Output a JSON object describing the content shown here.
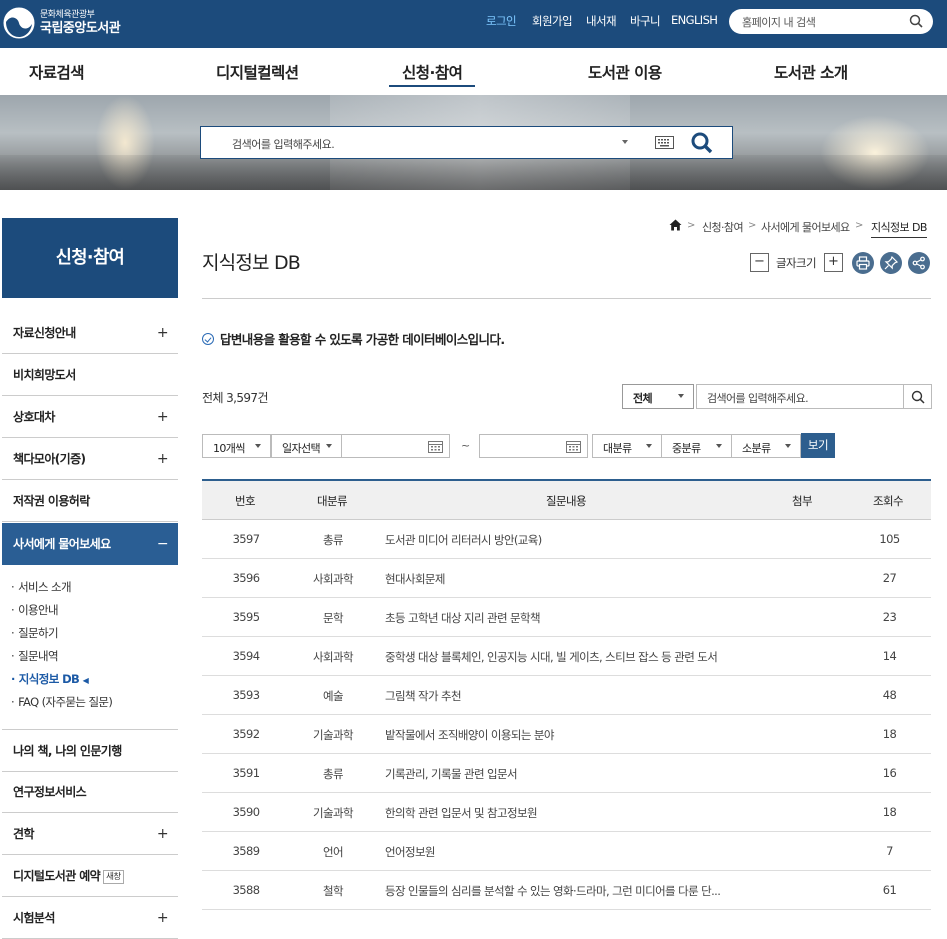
{
  "header": {
    "org_sub": "문화체육관광부",
    "org_main": "국립중앙도서관",
    "util_links": [
      "로그인",
      "회원가입",
      "내서재",
      "바구니",
      "ENGLISH"
    ],
    "site_search_placeholder": "홈페이지 내 검색"
  },
  "gnb": [
    "자료검색",
    "디지털컬렉션",
    "신청·참여",
    "도서관 이용",
    "도서관 소개"
  ],
  "main_search": {
    "placeholder": "검색어를 입력해주세요."
  },
  "sidebar": {
    "title": "신청·참여",
    "items": [
      {
        "label": "자료신청안내",
        "toggle": "+"
      },
      {
        "label": "비치희망도서",
        "toggle": ""
      },
      {
        "label": "상호대차",
        "toggle": "+"
      },
      {
        "label": "책다모아(기증)",
        "toggle": "+"
      },
      {
        "label": "저작권 이용허락",
        "toggle": ""
      },
      {
        "label": "사서에게 물어보세요",
        "toggle": "−"
      }
    ],
    "sub_items": [
      {
        "label": "서비스 소개"
      },
      {
        "label": "이용안내"
      },
      {
        "label": "질문하기"
      },
      {
        "label": "질문내역"
      },
      {
        "label": "지식정보 DB",
        "marker": "◀"
      },
      {
        "label": "FAQ (자주묻는 질문)"
      }
    ],
    "items_after": [
      {
        "label": "나의 책, 나의 인문기행",
        "toggle": ""
      },
      {
        "label": "연구정보서비스",
        "toggle": ""
      },
      {
        "label": "견학",
        "toggle": "+"
      },
      {
        "label": "디지털도서관 예약",
        "toggle": "",
        "badge": "새창"
      },
      {
        "label": "시험분석",
        "toggle": "+"
      }
    ]
  },
  "breadcrumb": [
    "신청·참여",
    "사서에게 물어보세요",
    "지식정보 DB"
  ],
  "page": {
    "title": "지식정보 DB",
    "font_size_label": "글자크기",
    "font_minus": "−",
    "font_plus": "+",
    "description": "답변내용을 활용할 수 있도록 가공한 데이터베이스입니다.",
    "total": "전체 3,597건"
  },
  "filters": {
    "scope": "전체",
    "keyword_placeholder": "검색어를 입력해주세요.",
    "page_size": "10개씩",
    "date_select": "일자선택",
    "tilde": "~",
    "cat_major": "대분류",
    "cat_middle": "중분류",
    "cat_minor": "소분류",
    "submit": "보기"
  },
  "table": {
    "headers": [
      "번호",
      "대분류",
      "질문내용",
      "첨부",
      "조회수"
    ],
    "rows": [
      {
        "no": "3597",
        "category": "총류",
        "question": "도서관 미디어 리터러시 방안(교육)",
        "attach": "",
        "views": "105"
      },
      {
        "no": "3596",
        "category": "사회과학",
        "question": "현대사회문제",
        "attach": "",
        "views": "27"
      },
      {
        "no": "3595",
        "category": "문학",
        "question": "초등 고학년 대상 지리 관련 문학책",
        "attach": "",
        "views": "23"
      },
      {
        "no": "3594",
        "category": "사회과학",
        "question": "중학생 대상 블록체인, 인공지능 시대, 빌 게이츠, 스티브 잡스 등 관련 도서",
        "attach": "",
        "views": "14"
      },
      {
        "no": "3593",
        "category": "예술",
        "question": "그림책 작가 추천",
        "attach": "",
        "views": "48"
      },
      {
        "no": "3592",
        "category": "기술과학",
        "question": "밭작물에서 조직배양이 이용되는 분야",
        "attach": "",
        "views": "18"
      },
      {
        "no": "3591",
        "category": "총류",
        "question": "기록관리, 기록물 관련 입문서",
        "attach": "",
        "views": "16"
      },
      {
        "no": "3590",
        "category": "기술과학",
        "question": "한의학 관련 입문서 및 참고정보원",
        "attach": "",
        "views": "18"
      },
      {
        "no": "3589",
        "category": "언어",
        "question": "언어정보원",
        "attach": "",
        "views": "7"
      },
      {
        "no": "3588",
        "category": "철학",
        "question": "등장 인물들의 심리를 분석할 수 있는 영화·드라마, 그런 미디어를 다룬 단...",
        "attach": "",
        "views": "61"
      }
    ]
  }
}
